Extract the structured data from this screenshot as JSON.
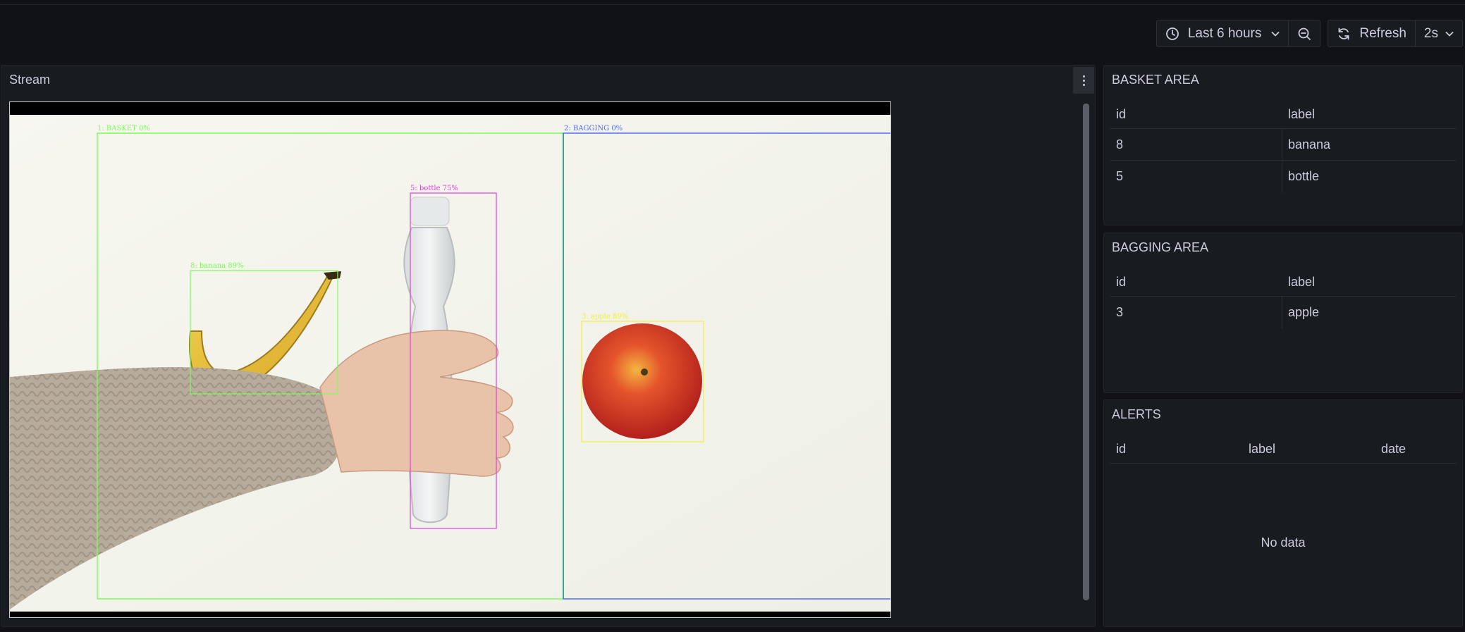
{
  "toolbar": {
    "time_range": "Last 6 hours",
    "refresh_label": "Refresh",
    "refresh_interval": "2s"
  },
  "stream": {
    "title": "Stream",
    "overlays": {
      "basket_zone": "1: BASKET 0%",
      "bagging_zone": "2: BAGGING 0%",
      "banana": "8: banana 89%",
      "bottle": "5: bottle 75%",
      "apple": "3: apple 89%"
    }
  },
  "basket_area": {
    "title": "BASKET AREA",
    "columns": [
      "id",
      "label"
    ],
    "rows": [
      {
        "id": "8",
        "label": "banana"
      },
      {
        "id": "5",
        "label": "bottle"
      }
    ]
  },
  "bagging_area": {
    "title": "BAGGING AREA",
    "columns": [
      "id",
      "label"
    ],
    "rows": [
      {
        "id": "3",
        "label": "apple"
      }
    ]
  },
  "alerts": {
    "title": "ALERTS",
    "columns": [
      "id",
      "label",
      "date"
    ],
    "empty_text": "No data"
  },
  "colors": {
    "background": "#111217",
    "panel": "#181b1f",
    "basket_box": "#7CFC5A",
    "bagging_box": "#4D6BFF",
    "bottle_box": "#E040E0",
    "apple_box": "#F2EE3C"
  }
}
